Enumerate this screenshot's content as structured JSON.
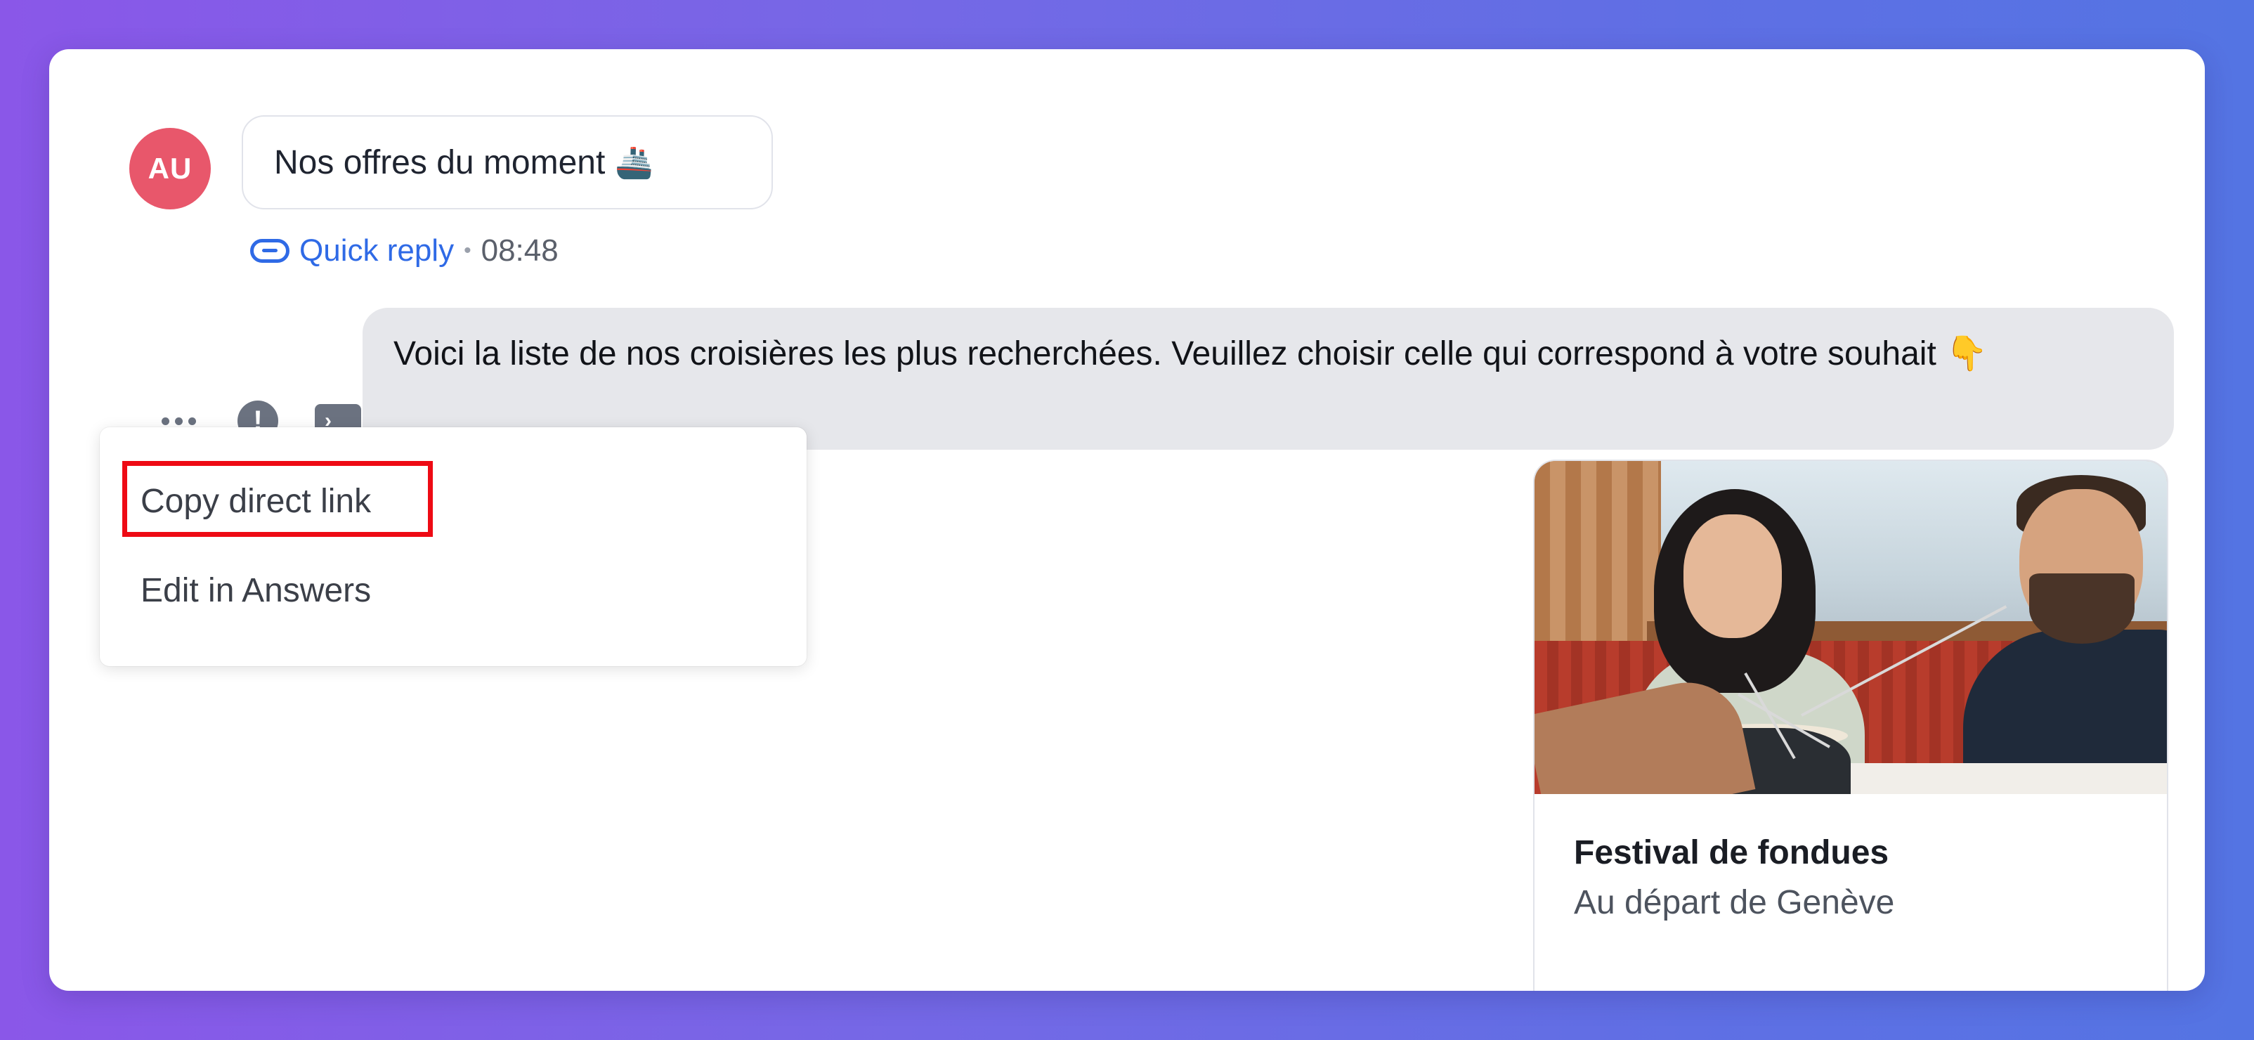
{
  "conversation": {
    "user_message": {
      "avatar_initials": "AU",
      "avatar_color": "#e8576b",
      "text": "Nos offres du moment",
      "emoji": "🚢"
    },
    "meta": {
      "icon": "quick-reply-icon",
      "label": "Quick reply",
      "separator": "•",
      "time": "08:48",
      "label_color": "#2f6ae6"
    },
    "bot_message": {
      "text": "Voici la liste de nos croisières les plus recherchées. Veuillez choisir celle qui correspond à votre souhait 👇"
    },
    "message_actions": [
      {
        "icon": "more-dots-icon"
      },
      {
        "icon": "alert-icon",
        "glyph": "!"
      },
      {
        "icon": "terminal-icon",
        "glyph": "›"
      }
    ],
    "context_menu": {
      "items": [
        {
          "label": "Copy direct link",
          "highlighted": true
        },
        {
          "label": "Edit in Answers"
        }
      ],
      "highlight_color": "#ee0a14"
    },
    "carousel_card": {
      "image": "fondue-dinner-photo",
      "title": "Festival de fondues",
      "subtitle": "Au départ de Genève"
    }
  }
}
